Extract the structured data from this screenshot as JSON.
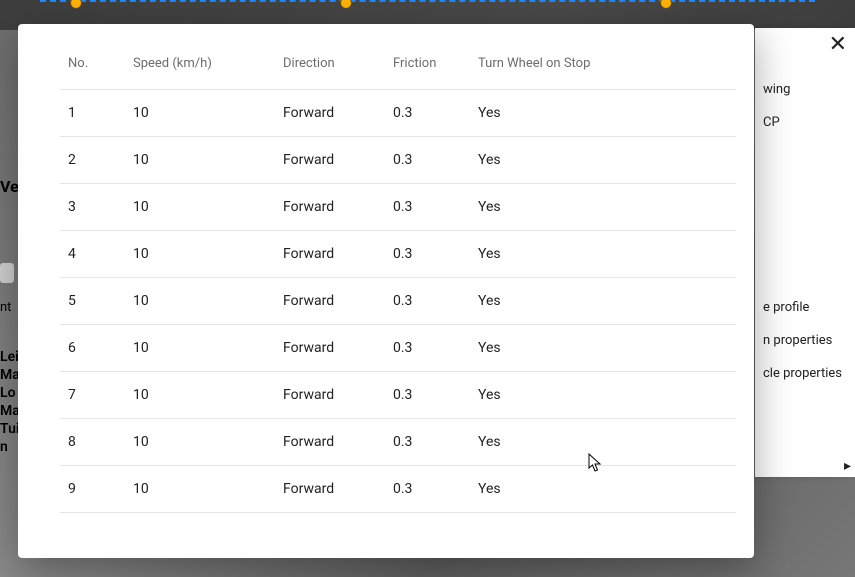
{
  "table": {
    "headers": {
      "no": "No.",
      "speed": "Speed (km/h)",
      "direction": "Direction",
      "friction": "Friction",
      "turn": "Turn Wheel on Stop"
    },
    "rows": [
      {
        "no": "1",
        "speed": "10",
        "direction": "Forward",
        "friction": "0.3",
        "turn": "Yes"
      },
      {
        "no": "2",
        "speed": "10",
        "direction": "Forward",
        "friction": "0.3",
        "turn": "Yes"
      },
      {
        "no": "3",
        "speed": "10",
        "direction": "Forward",
        "friction": "0.3",
        "turn": "Yes"
      },
      {
        "no": "4",
        "speed": "10",
        "direction": "Forward",
        "friction": "0.3",
        "turn": "Yes"
      },
      {
        "no": "5",
        "speed": "10",
        "direction": "Forward",
        "friction": "0.3",
        "turn": "Yes"
      },
      {
        "no": "6",
        "speed": "10",
        "direction": "Forward",
        "friction": "0.3",
        "turn": "Yes"
      },
      {
        "no": "7",
        "speed": "10",
        "direction": "Forward",
        "friction": "0.3",
        "turn": "Yes"
      },
      {
        "no": "8",
        "speed": "10",
        "direction": "Forward",
        "friction": "0.3",
        "turn": "Yes"
      },
      {
        "no": "9",
        "speed": "10",
        "direction": "Forward",
        "friction": "0.3",
        "turn": "Yes"
      }
    ]
  },
  "side_panel": {
    "item_wing": "wing",
    "item_cp": "CP",
    "item_profile": "e profile",
    "item_props1": "n properties",
    "item_props2": "cle properties"
  },
  "left_fragments": {
    "ve": "Ve",
    "nt": "nt",
    "block": "Lei\nMa\nLo\nMa\nTui\nn"
  },
  "top_handle_positions": [
    70,
    340,
    660
  ]
}
